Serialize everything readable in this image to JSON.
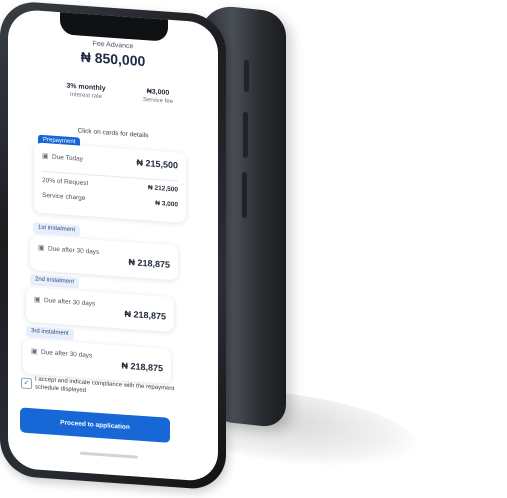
{
  "app": {
    "fee_title": "Fee Advance",
    "fee_amount": "₦ 850,000",
    "metrics": [
      {
        "value": "3% monthly",
        "label": "Interest rate"
      },
      {
        "value": "₦3,000",
        "label": "Service fee"
      }
    ],
    "hint": "Click on cards for details"
  },
  "prepayment": {
    "label": "Prepayment",
    "due_text": "Due Today",
    "amount": "₦ 215,500",
    "rows": [
      {
        "label": "20% of Request",
        "value": "₦ 212,500"
      },
      {
        "label": "Service charge",
        "value": "₦ 3,000"
      }
    ]
  },
  "instalments": [
    {
      "label": "1st instalment",
      "due_text": "Due after 30 days",
      "amount": "₦ 218,875"
    },
    {
      "label": "2nd instalment",
      "due_text": "Due after 30 days",
      "amount": "₦ 218,875"
    },
    {
      "label": "3rd instalment",
      "due_text": "Due after 30 days",
      "amount": "₦ 218,875"
    }
  ],
  "consent": {
    "text": "I accept and indicate compliance with the repayment schedule displayed"
  },
  "cta": {
    "label": "Proceed to application"
  },
  "colors": {
    "primary": "#1767d6",
    "badge_light": "#e7eefc"
  },
  "icons": {
    "calendar": "calendar-icon",
    "check": "check-icon"
  }
}
